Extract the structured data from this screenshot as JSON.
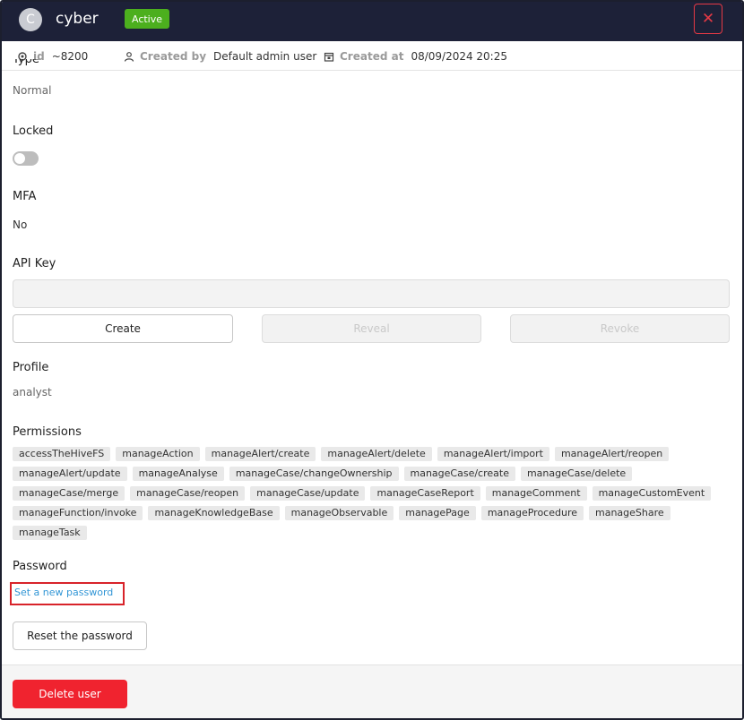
{
  "header": {
    "avatar_initial": "C",
    "username": "cyber",
    "status": "Active"
  },
  "meta": {
    "id_label": "id",
    "id_value": "~8200",
    "created_by_label": "Created by",
    "created_by_value": "Default admin user",
    "created_at_label": "Created at",
    "created_at_value": "08/09/2024 20:25"
  },
  "fields": {
    "type_label": "Type",
    "type_value": "Normal",
    "locked_label": "Locked",
    "locked_on": false,
    "mfa_label": "MFA",
    "mfa_value": "No",
    "apikey_label": "API Key",
    "apikey_value": "",
    "create_label": "Create",
    "reveal_label": "Reveal",
    "revoke_label": "Revoke",
    "profile_label": "Profile",
    "profile_value": "analyst",
    "permissions_label": "Permissions",
    "password_label": "Password",
    "set_password_label": "Set a new password",
    "reset_password_label": "Reset the password"
  },
  "permissions": [
    [
      "accessTheHiveFS",
      "manageAction",
      "manageAlert/create",
      "manageAlert/delete",
      "manageAlert/import",
      "manageAlert/reopen"
    ],
    [
      "manageAlert/update",
      "manageAnalyse",
      "manageCase/changeOwnership",
      "manageCase/create",
      "manageCase/delete"
    ],
    [
      "manageCase/merge",
      "manageCase/reopen",
      "manageCase/update",
      "manageCaseReport",
      "manageComment",
      "manageCustomEvent"
    ],
    [
      "manageFunction/invoke",
      "manageKnowledgeBase",
      "manageObservable",
      "managePage",
      "manageProcedure",
      "manageShare"
    ],
    [
      "manageTask"
    ]
  ],
  "footer": {
    "delete_label": "Delete user"
  },
  "colors": {
    "topbar": "#1d2138",
    "active_badge": "#4caf1e",
    "danger": "#f0232f",
    "link": "#3296d6"
  }
}
